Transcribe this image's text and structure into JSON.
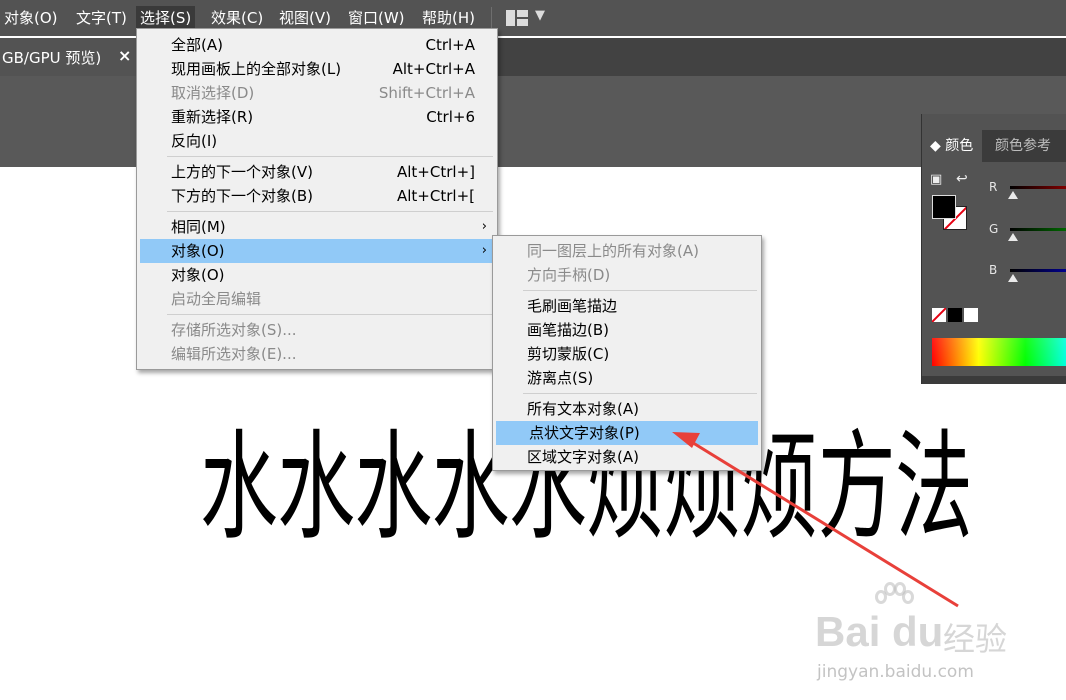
{
  "menubar": {
    "items": [
      "对象(O)",
      "文字(T)",
      "选择(S)",
      "效果(C)",
      "视图(V)",
      "窗口(W)",
      "帮助(H)"
    ],
    "workspace_icon": "grid-layout-icon"
  },
  "doc_tab": {
    "label": "GB/GPU 预览)",
    "close": "×"
  },
  "select_menu": {
    "items": [
      {
        "label": "全部(A)",
        "shortcut": "Ctrl+A"
      },
      {
        "label": "现用画板上的全部对象(L)",
        "shortcut": "Alt+Ctrl+A"
      },
      {
        "label": "取消选择(D)",
        "shortcut": "Shift+Ctrl+A"
      },
      {
        "label": "重新选择(R)",
        "shortcut": "Ctrl+6"
      },
      {
        "label": "反向(I)",
        "shortcut": ""
      },
      {
        "label": "上方的下一个对象(V)",
        "shortcut": "Alt+Ctrl+]"
      },
      {
        "label": "下方的下一个对象(B)",
        "shortcut": "Alt+Ctrl+["
      },
      {
        "label": "相同(M)",
        "shortcut": "›"
      },
      {
        "label": "对象(O)",
        "shortcut": "›"
      },
      {
        "label": "对象(O)",
        "shortcut": ""
      },
      {
        "label": "启动全局编辑",
        "shortcut": ""
      },
      {
        "label": "存储所选对象(S)...",
        "shortcut": ""
      },
      {
        "label": "编辑所选对象(E)...",
        "shortcut": ""
      }
    ]
  },
  "object_submenu": {
    "items": [
      "同一图层上的所有对象(A)",
      "方向手柄(D)",
      "毛刷画笔描边",
      "画笔描边(B)",
      "剪切蒙版(C)",
      "游离点(S)",
      "所有文本对象(A)",
      "点状文字对象(P)",
      "区域文字对象(A)"
    ]
  },
  "color_panel": {
    "tab_active": "颜色",
    "tab_inactive": "颜色参考",
    "channels": [
      "R",
      "G",
      "B"
    ]
  },
  "canvas": {
    "text": "水水水水水烦烦烦方法"
  },
  "watermark": {
    "logo": "Bai du",
    "cn": "经验",
    "url": "jingyan.baidu.com"
  }
}
